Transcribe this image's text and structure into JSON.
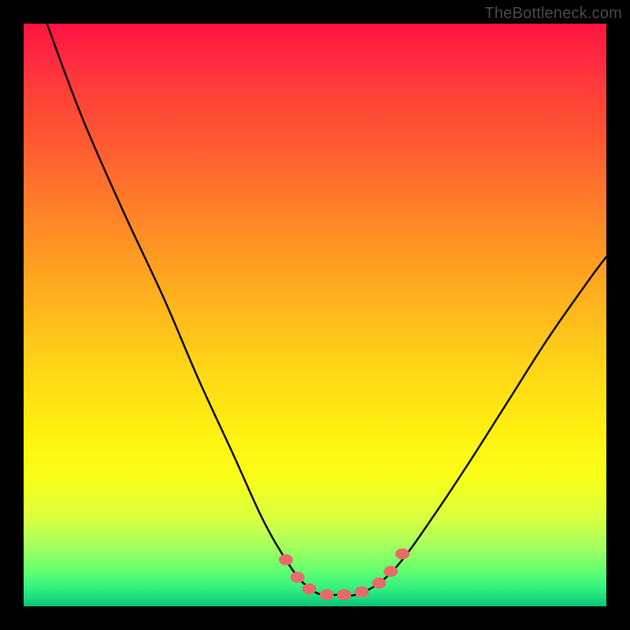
{
  "credit_text": "TheBottleneck.com",
  "colors": {
    "frame": "#000000",
    "curve_stroke": "#000000",
    "marker_fill": "#e96a6a",
    "marker_stroke": "#c44a4a"
  },
  "chart_data": {
    "type": "line",
    "title": "",
    "xlabel": "",
    "ylabel": "",
    "xlim": [
      0,
      100
    ],
    "ylim": [
      0,
      100
    ],
    "grid": false,
    "legend": false,
    "annotations": [
      {
        "text": "TheBottleneck.com",
        "position": "top-right"
      }
    ],
    "series": [
      {
        "name": "bottleneck-curve",
        "x": [
          4,
          10,
          17,
          24,
          30,
          36,
          41,
          45,
          48,
          51,
          54,
          57,
          61,
          65,
          70,
          76,
          83,
          90,
          97,
          100
        ],
        "values": [
          100,
          84,
          68,
          53,
          39,
          26,
          15,
          8,
          4,
          2,
          2,
          2,
          4,
          8,
          15,
          24,
          35,
          46,
          56,
          60
        ]
      }
    ],
    "markers": {
      "x": [
        45,
        47,
        49,
        52,
        55,
        58,
        61,
        63,
        65
      ],
      "values": [
        8,
        5,
        3,
        2,
        2,
        2.5,
        4,
        6,
        9
      ]
    }
  }
}
